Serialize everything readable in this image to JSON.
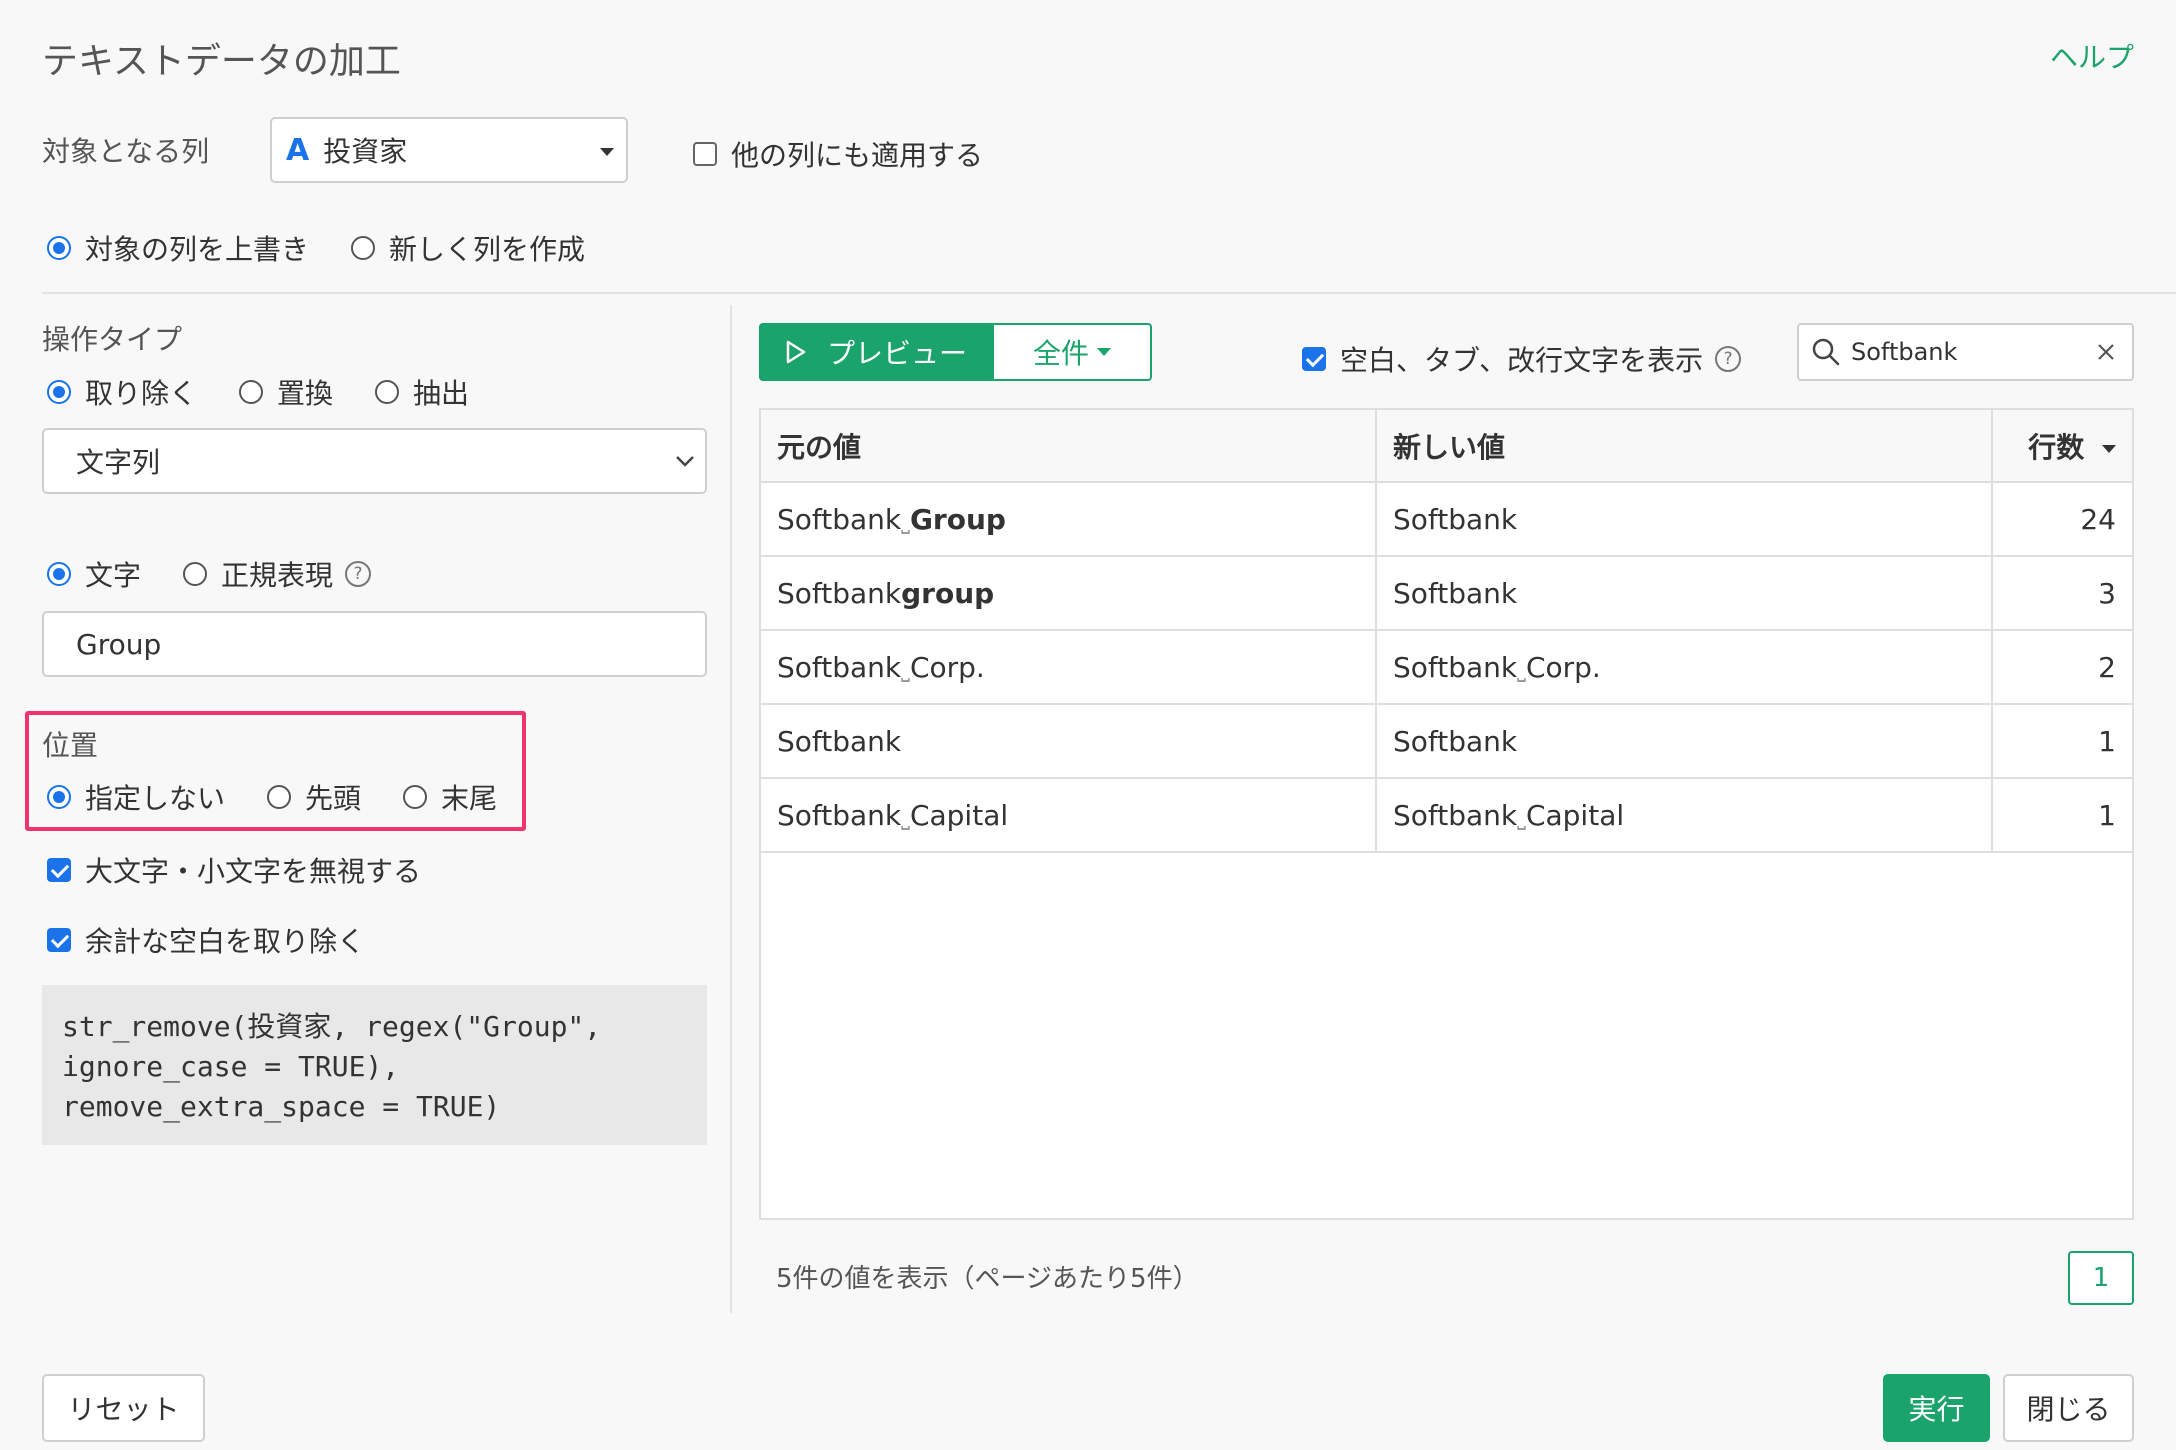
{
  "dialog": {
    "title": "テキストデータの加工",
    "help": "ヘルプ"
  },
  "target_column": {
    "label": "対象となる列",
    "type_icon": "A",
    "value": "投資家",
    "apply_other_label": "他の列にも適用する",
    "apply_other_checked": false
  },
  "output_mode": {
    "overwrite_label": "対象の列を上書き",
    "new_column_label": "新しく列を作成",
    "selected": "overwrite"
  },
  "operation": {
    "label": "操作タイプ",
    "options": [
      "取り除く",
      "置換",
      "抽出"
    ],
    "selected": 0,
    "target_select": "文字列"
  },
  "match_mode": {
    "literal_label": "文字",
    "regex_label": "正規表現",
    "help_icon": "?",
    "selected": "literal",
    "pattern": "Group"
  },
  "position": {
    "label": "位置",
    "options": [
      "指定しない",
      "先頭",
      "末尾"
    ],
    "selected": 0
  },
  "options": {
    "ignore_case_label": "大文字・小文字を無視する",
    "ignore_case_checked": true,
    "remove_space_label": "余計な空白を取り除く",
    "remove_space_checked": true
  },
  "code": {
    "line1": "str_remove(投資家, regex(\"Group\",",
    "line2": "ignore_case = TRUE),",
    "line3": "remove_extra_space = TRUE)"
  },
  "preview": {
    "preview_button": "プレビュー",
    "all_button": "全件",
    "show_whitespace_label": "空白、タブ、改行文字を表示",
    "show_whitespace_checked": true,
    "help_icon": "?",
    "search_value": "Softbank"
  },
  "table": {
    "headers": {
      "original": "元の値",
      "new": "新しい値",
      "count": "行数"
    },
    "space_symbol": "⎵",
    "rows": [
      {
        "orig_a": "Softbank",
        "orig_space": true,
        "orig_b": "Group",
        "orig_b_bold": true,
        "new_a": "Softbank",
        "new_space": false,
        "new_b": "",
        "count": "24"
      },
      {
        "orig_a": "Softbank",
        "orig_space": false,
        "orig_b": "group",
        "orig_b_bold": true,
        "new_a": "Softbank",
        "new_space": false,
        "new_b": "",
        "count": "3"
      },
      {
        "orig_a": "Softbank",
        "orig_space": true,
        "orig_b": "Corp.",
        "orig_b_bold": false,
        "new_a": "Softbank",
        "new_space": true,
        "new_b": "Corp.",
        "count": "2"
      },
      {
        "orig_a": "Softbank",
        "orig_space": false,
        "orig_b": "",
        "orig_b_bold": false,
        "new_a": "Softbank",
        "new_space": false,
        "new_b": "",
        "count": "1"
      },
      {
        "orig_a": "Softbank",
        "orig_space": true,
        "orig_b": "Capital",
        "orig_b_bold": false,
        "new_a": "Softbank",
        "new_space": true,
        "new_b": "Capital",
        "count": "1"
      }
    ]
  },
  "pagination": {
    "summary": "5件の値を表示（ページあたり5件）",
    "current_page": "1"
  },
  "footer": {
    "reset": "リセット",
    "run": "実行",
    "close": "閉じる"
  },
  "colors": {
    "accent_green": "#1aa36a",
    "radio_blue": "#1a73e8",
    "highlight_pink": "#f0336e"
  }
}
